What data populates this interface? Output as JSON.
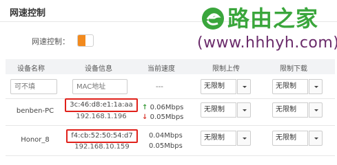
{
  "panel": {
    "title": "网速控制"
  },
  "speed_control": {
    "label": "网速控制：",
    "enabled": true,
    "accent": "#f28a1e"
  },
  "watermark": {
    "brand": "路由之家",
    "url": "(www.hhhyh.com)",
    "brand_color": "#3aa63c",
    "url_color": "#6a2b6a"
  },
  "table": {
    "headers": [
      "设备名称",
      "设备信息",
      "当前速度",
      "限制上传",
      "限制下载"
    ],
    "filter_row": {
      "name_placeholder": "可不填",
      "mac_placeholder": "MAC地址",
      "speed": "---",
      "upload": "无限制",
      "download": "无限制"
    },
    "rows": [
      {
        "name": "benben-PC",
        "mac": "3c:46:d8:e1:1a:aa",
        "ip": "192.168.1.196",
        "up_speed": "0.06Mbps",
        "down_speed": "0.05Mbps",
        "upload": "无限制",
        "download": "无限制"
      },
      {
        "name": "Honor_8",
        "mac": "f4:cb:52:50:54:d7",
        "ip": "192.168.10.159",
        "up_speed": "0.04Mbps",
        "down_speed": "0.05Mbps",
        "upload": "无限制",
        "download": "无限制"
      }
    ]
  },
  "highlight_color": "#e0201a"
}
